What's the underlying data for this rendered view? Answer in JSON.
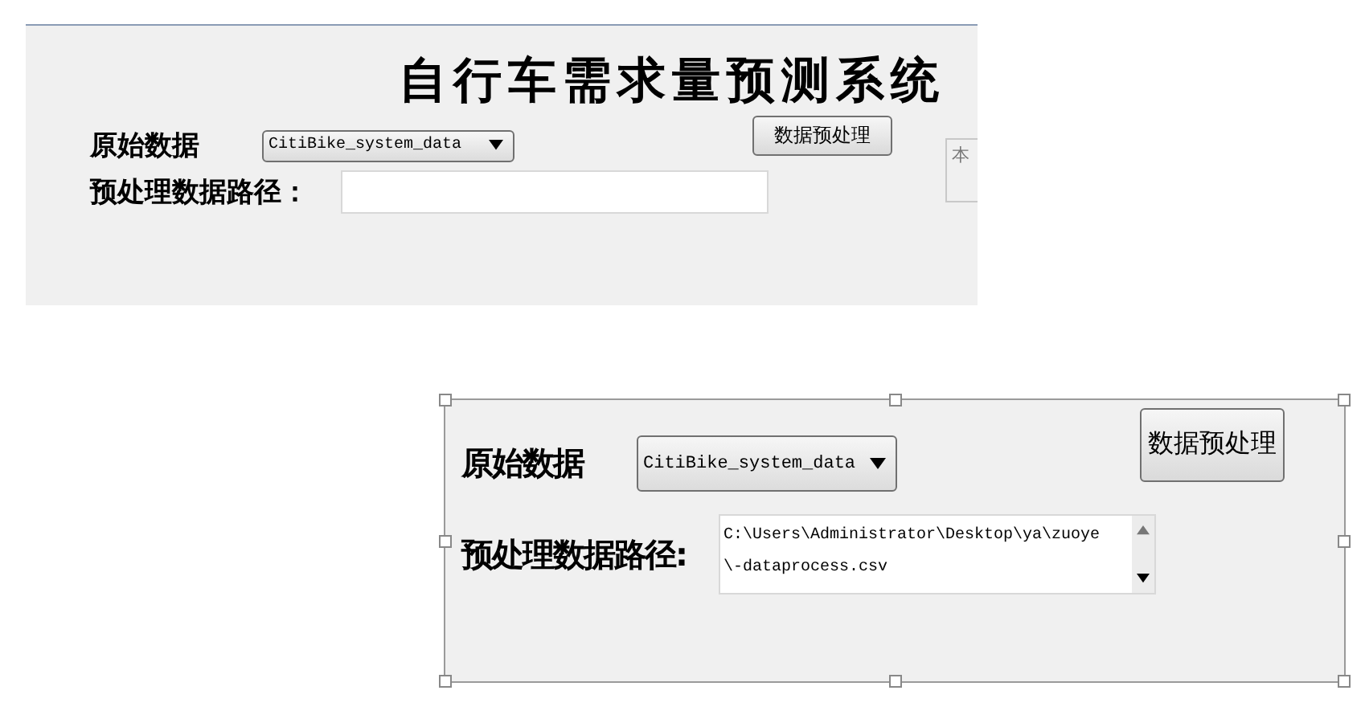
{
  "form_top": {
    "title": "自行车需求量预测系统",
    "raw_data_label": "原始数据",
    "dataset_select": "CitiBike_system_data",
    "preprocess_button": "数据预处理",
    "path_label": "预处理数据路径：",
    "side_box": "本"
  },
  "form_bottom": {
    "selected": true,
    "raw_data_label": "原始数据",
    "dataset_select": "CitiBike_system_data",
    "preprocess_button": "数据预处理",
    "path_label": "预处理数据路径:",
    "path_lines": [
      "C:\\Users\\Administrator\\Desktop\\ya\\zuoye",
      "\\-dataprocess.csv"
    ]
  }
}
